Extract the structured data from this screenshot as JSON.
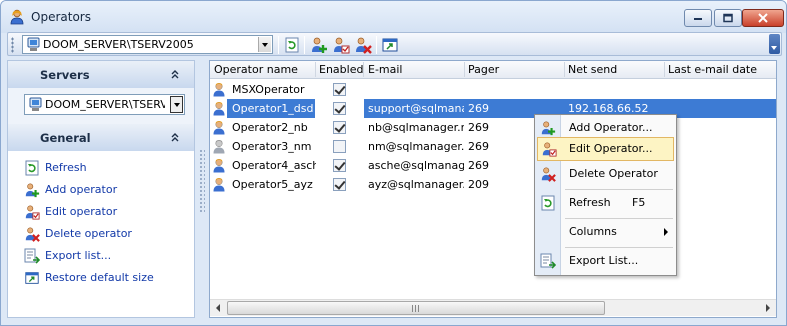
{
  "window": {
    "title": "Operators",
    "icon": "operator-icon"
  },
  "toolbar": {
    "server_combo": "DOOM_SERVER\\TSERV2005",
    "buttons": [
      "refresh-icon",
      "add-operator-icon",
      "edit-operator-icon",
      "delete-operator-icon",
      "restore-size-icon"
    ]
  },
  "sidebar": {
    "servers_header": "Servers",
    "server_combo": "DOOM_SERVER\\TSERV",
    "general_header": "General",
    "items": [
      {
        "label": "Refresh",
        "icon": "refresh-icon"
      },
      {
        "label": "Add operator",
        "icon": "add-operator-icon"
      },
      {
        "label": "Edit operator",
        "icon": "edit-operator-icon"
      },
      {
        "label": "Delete operator",
        "icon": "delete-operator-icon"
      },
      {
        "label": "Export list...",
        "icon": "export-list-icon"
      },
      {
        "label": "Restore default size",
        "icon": "restore-size-icon"
      }
    ]
  },
  "grid": {
    "columns": [
      "Operator name",
      "Enabled",
      "E-mail",
      "Pager",
      "Net send",
      "Last e-mail date"
    ],
    "rows": [
      {
        "name": "MSXOperator",
        "enabled": true,
        "email": "",
        "pager": "",
        "netsend": "",
        "disabled_icon": false
      },
      {
        "name": "Operator1_dsd",
        "enabled": true,
        "email": "support@sqlmanager.net",
        "pager": "269",
        "netsend": "192.168.66.52",
        "disabled_icon": false
      },
      {
        "name": "Operator2_nb",
        "enabled": true,
        "email": "nb@sqlmanager.net",
        "pager": "269",
        "netsend": "",
        "disabled_icon": false
      },
      {
        "name": "Operator3_nm",
        "enabled": false,
        "email": "nm@sqlmanager.net",
        "pager": "269",
        "netsend": "",
        "disabled_icon": true
      },
      {
        "name": "Operator4_asche",
        "enabled": true,
        "email": "asche@sqlmanager.net",
        "pager": "269",
        "netsend": "",
        "disabled_icon": false
      },
      {
        "name": "Operator5_ayz",
        "enabled": true,
        "email": "ayz@sqlmanager.net",
        "pager": "209",
        "netsend": "",
        "disabled_icon": false
      }
    ],
    "selected_row": 1
  },
  "context_menu": {
    "items": [
      {
        "label": "Add Operator...",
        "shortcut": "",
        "icon": "add-operator-icon"
      },
      {
        "label": "Edit Operator...",
        "shortcut": "",
        "icon": "edit-operator-icon"
      },
      {
        "label": "Delete Operator",
        "shortcut": "",
        "icon": "delete-operator-icon"
      },
      {
        "label": "Refresh",
        "shortcut": "F5",
        "icon": "refresh-icon"
      },
      {
        "label": "Columns",
        "shortcut": "",
        "icon": ""
      },
      {
        "label": "Export List...",
        "shortcut": "",
        "icon": "export-list-icon"
      }
    ],
    "hovered_index": 1
  },
  "colors": {
    "selection": "#3d7bd4",
    "link": "#1239a8",
    "menu_hover": "#fdf4c4"
  }
}
